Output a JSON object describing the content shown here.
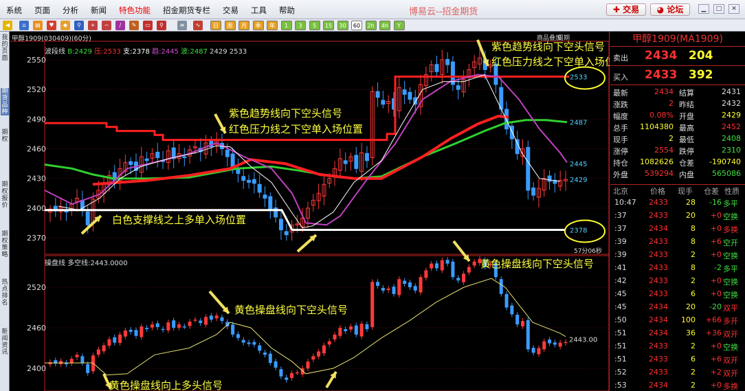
{
  "menubar": {
    "items": [
      "系统",
      "页面",
      "分析",
      "新闻",
      "特色功能",
      "招金期货专栏",
      "交易",
      "工具",
      "帮助"
    ],
    "highlighted_index": 4,
    "app_title": "博易云--招金期货",
    "trade_button": "交易",
    "forum_button": "论坛"
  },
  "toolbar": {
    "period_buttons": [
      "日",
      "周",
      "月",
      "季",
      "年",
      "1",
      "3",
      "5",
      "15",
      "30",
      "60",
      "2h",
      "4h",
      "Y"
    ],
    "active_period": "60"
  },
  "left_tabs": [
    "我的页面",
    "期货品种",
    "期权",
    "期权报价",
    "期权策略",
    "热点排名",
    "新闻资讯"
  ],
  "chart": {
    "symbol_header": "甲醇1909(030409)(60分)",
    "indicator_label": "波段线",
    "B_label": "B:",
    "B_value": "2429",
    "pressure_label": "压:",
    "pressure_value": "2533",
    "support_label": "支:",
    "support_value": "2378",
    "trend_label": "趋:",
    "trend_value": "2445",
    "wave_label": "波:",
    "wave_value": "2487",
    "extra1": "2429",
    "extra2": "2533",
    "overlay_link": "商品叠加",
    "cycle_link": "周期",
    "countdown": "57分06秒",
    "sub_indicator_label": "操盘线",
    "sub_indicator_value": "多空线:2443.0000",
    "price_labels": {
      "resistance": "2533",
      "green": "2487",
      "purple": "2445",
      "last": "2429",
      "support": "2378",
      "sub_last": "2443.00"
    },
    "annotations": {
      "top_right_1": "紫色趋势线向下空头信号",
      "top_right_2": "红色压力线之下空单入场位置",
      "mid_1": "紫色趋势线向下空头信号",
      "mid_2": "红色压力线之下空单入场位置",
      "support_text": "白色支撑线之上多单入场位置",
      "sub_mid": "黄色操盘线向下空头信号",
      "sub_right": "黄色操盘线向下空头信号",
      "sub_bottom": "黄色操盘线向上多头信号"
    },
    "colors": {
      "up": "#ff3a3a",
      "down": "#3a9cff",
      "resistance": "#ff2020",
      "support": "#ffffff",
      "trend": "#c040c0",
      "wave": "#30d030",
      "sub_line": "#e8e070",
      "annotation": "#ffff40",
      "arrow": "#f0e060"
    },
    "chart_data": {
      "type": "candlestick",
      "main_yaxis_ticks": [
        2550,
        2520,
        2490,
        2460,
        2430,
        2400,
        2370
      ],
      "sub_yaxis_ticks": [
        2520,
        2460,
        2400
      ],
      "candles_close": [
        2399,
        2397,
        2401,
        2396,
        2404,
        2410,
        2398,
        2383,
        2409,
        2418,
        2424,
        2433,
        2428,
        2440,
        2446,
        2444,
        2438,
        2452,
        2448,
        2455,
        2451,
        2447,
        2458,
        2450,
        2455,
        2452,
        2459,
        2462,
        2457,
        2466,
        2462,
        2468,
        2460,
        2452,
        2440,
        2435,
        2428,
        2426,
        2425,
        2416,
        2410,
        2398,
        2391,
        2378,
        2373,
        2383,
        2384,
        2390,
        2400,
        2408,
        2415,
        2424,
        2430,
        2440,
        2450,
        2445,
        2452,
        2440,
        2456,
        2448,
        2518,
        2512,
        2505,
        2508,
        2500,
        2522,
        2515,
        2510,
        2505,
        2525,
        2535,
        2545,
        2538,
        2550,
        2545,
        2525,
        2520,
        2530,
        2540,
        2548,
        2552,
        2540,
        2545,
        2525,
        2500,
        2480,
        2470,
        2455,
        2460,
        2418,
        2413,
        2420,
        2430,
        2427,
        2425,
        2428,
        2429
      ]
    }
  },
  "right_panel": {
    "title": "甲醇1909(MA1909)",
    "sell_label": "卖出",
    "sell_price": "2434",
    "sell_vol": "204",
    "buy_label": "买入",
    "buy_price": "2433",
    "buy_vol": "392",
    "stats": [
      {
        "l1": "最新",
        "v1": "2434",
        "c1": "#ff3030",
        "l2": "结算",
        "v2": "2431",
        "c2": "#ddd"
      },
      {
        "l1": "涨跌",
        "v1": "2",
        "c1": "#ff3030",
        "l2": "昨结",
        "v2": "2432",
        "c2": "#ddd"
      },
      {
        "l1": "幅度",
        "v1": "0.08%",
        "c1": "#ff3030",
        "l2": "开盘",
        "v2": "2429",
        "c2": "#ffff30"
      },
      {
        "l1": "总手",
        "v1": "1104380",
        "c1": "#ffff30",
        "l2": "最高",
        "v2": "2452",
        "c2": "#ff3030"
      },
      {
        "l1": "现手",
        "v1": "2",
        "c1": "#ffff30",
        "l2": "最低",
        "v2": "2408",
        "c2": "#40e040"
      },
      {
        "l1": "涨停",
        "v1": "2554",
        "c1": "#ff3030",
        "l2": "跌停",
        "v2": "2310",
        "c2": "#40e040"
      },
      {
        "l1": "持仓",
        "v1": "1082626",
        "c1": "#ffff30",
        "l2": "仓差",
        "v2": "-190740",
        "c2": "#ffff30"
      },
      {
        "l1": "外盘",
        "v1": "539294",
        "c1": "#ff3030",
        "l2": "内盘",
        "v2": "565086",
        "c2": "#40e040"
      }
    ],
    "ticks_header": {
      "time": "北京",
      "price": "价格",
      "vol": "现手",
      "oi": "仓差",
      "nature": "性质"
    },
    "ticks": [
      {
        "t": "10:47",
        "p": "2433",
        "v": "28",
        "o": "-16",
        "n": "多平",
        "oc": "#40e040",
        "nc": "#40e040"
      },
      {
        "t": ":37",
        "p": "2433",
        "v": "20",
        "o": "+0",
        "n": "空换",
        "oc": "#ff3030",
        "nc": "#40e040"
      },
      {
        "t": ":37",
        "p": "2434",
        "v": "8",
        "o": "+0",
        "n": "多换",
        "oc": "#ff3030",
        "nc": "#ff3030"
      },
      {
        "t": ":39",
        "p": "2433",
        "v": "8",
        "o": "+6",
        "n": "空开",
        "oc": "#ff3030",
        "nc": "#40e040"
      },
      {
        "t": ":39",
        "p": "2433",
        "v": "2",
        "o": "+0",
        "n": "空换",
        "oc": "#ff3030",
        "nc": "#40e040"
      },
      {
        "t": ":41",
        "p": "2433",
        "v": "8",
        "o": "-2",
        "n": "多平",
        "oc": "#40e040",
        "nc": "#40e040"
      },
      {
        "t": ":42",
        "p": "2433",
        "v": "2",
        "o": "+0",
        "n": "空换",
        "oc": "#ff3030",
        "nc": "#40e040"
      },
      {
        "t": ":45",
        "p": "2433",
        "v": "6",
        "o": "+0",
        "n": "空换",
        "oc": "#ff3030",
        "nc": "#40e040"
      },
      {
        "t": ":45",
        "p": "2434",
        "v": "20",
        "o": "-20",
        "n": "双平",
        "oc": "#40e040",
        "nc": "#ff3030"
      },
      {
        "t": ":50",
        "p": "2434",
        "v": "100",
        "o": "+66",
        "n": "多开",
        "oc": "#ff3030",
        "nc": "#ff3030"
      },
      {
        "t": ":51",
        "p": "2434",
        "v": "36",
        "o": "+36",
        "n": "双开",
        "oc": "#ff3030",
        "nc": "#ff3030"
      },
      {
        "t": ":51",
        "p": "2433",
        "v": "2",
        "o": "+0",
        "n": "空换",
        "oc": "#ff3030",
        "nc": "#40e040"
      },
      {
        "t": ":51",
        "p": "2433",
        "v": "6",
        "o": "+6",
        "n": "双开",
        "oc": "#ff3030",
        "nc": "#ff3030"
      },
      {
        "t": ":52",
        "p": "2433",
        "v": "2",
        "o": "+2",
        "n": "双开",
        "oc": "#ff3030",
        "nc": "#ff3030"
      },
      {
        "t": ":53",
        "p": "2434",
        "v": "2",
        "o": "+0",
        "n": "多换",
        "oc": "#ff3030",
        "nc": "#ff3030"
      }
    ]
  }
}
